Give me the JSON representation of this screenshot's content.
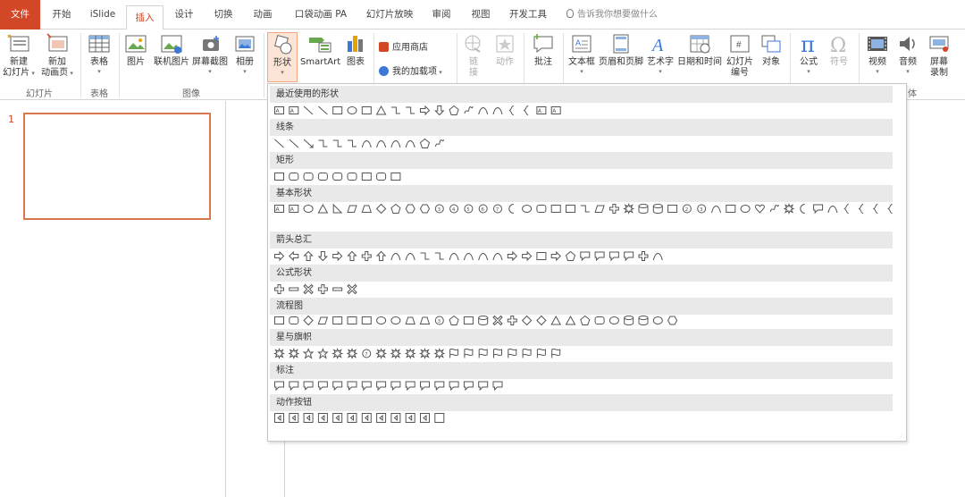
{
  "tabs": {
    "file": "文件",
    "home": "开始",
    "islide": "iSlide",
    "insert": "插入",
    "design": "设计",
    "transitions": "切换",
    "animations": "动画",
    "pocket": "口袋动画 PA",
    "slideshow": "幻灯片放映",
    "review": "审阅",
    "view": "视图",
    "developer": "开发工具",
    "tellme": "告诉我你想要做什么"
  },
  "ribbon": {
    "new_slide": [
      "新建",
      "幻灯片"
    ],
    "new_anim_page": [
      "新加",
      "动画页"
    ],
    "table": "表格",
    "picture": "图片",
    "online_picture": "联机图片",
    "screenshot": "屏幕截图",
    "album": "相册",
    "shapes": "形状",
    "smartart": "SmartArt",
    "chart": "图表",
    "app_store": "应用商店",
    "my_addins": "我的加载项",
    "link": [
      "链",
      "接"
    ],
    "action": "动作",
    "comment": "批注",
    "textbox": "文本框",
    "header_footer": "页眉和页脚",
    "wordart": "艺术字",
    "datetime": "日期和时间",
    "slide_number": [
      "幻灯片",
      "编号"
    ],
    "object": "对象",
    "equation": "公式",
    "symbol": "符号",
    "video": "视频",
    "audio": "音频",
    "screen_record": [
      "屏幕",
      "录制"
    ],
    "groups": {
      "slides": "幻灯片",
      "tables": "表格",
      "images": "图像",
      "media_tail": "体"
    }
  },
  "slides": {
    "number": "1"
  },
  "gallery": {
    "sections": [
      {
        "title": "最近使用的形状",
        "count": 20
      },
      {
        "title": "线条",
        "count": 12
      },
      {
        "title": "矩形",
        "count": 9
      },
      {
        "title": "基本形状",
        "count": 43
      },
      {
        "title": "箭头总汇",
        "count": 27
      },
      {
        "title": "公式形状",
        "count": 6
      },
      {
        "title": "流程图",
        "count": 28
      },
      {
        "title": "星与旗帜",
        "count": 20
      },
      {
        "title": "标注",
        "count": 16
      },
      {
        "title": "动作按钮",
        "count": 12
      }
    ]
  },
  "colors": {
    "accent": "#d24726",
    "selected_bg": "#fce4d6",
    "section_bg": "#e9e9e9"
  }
}
